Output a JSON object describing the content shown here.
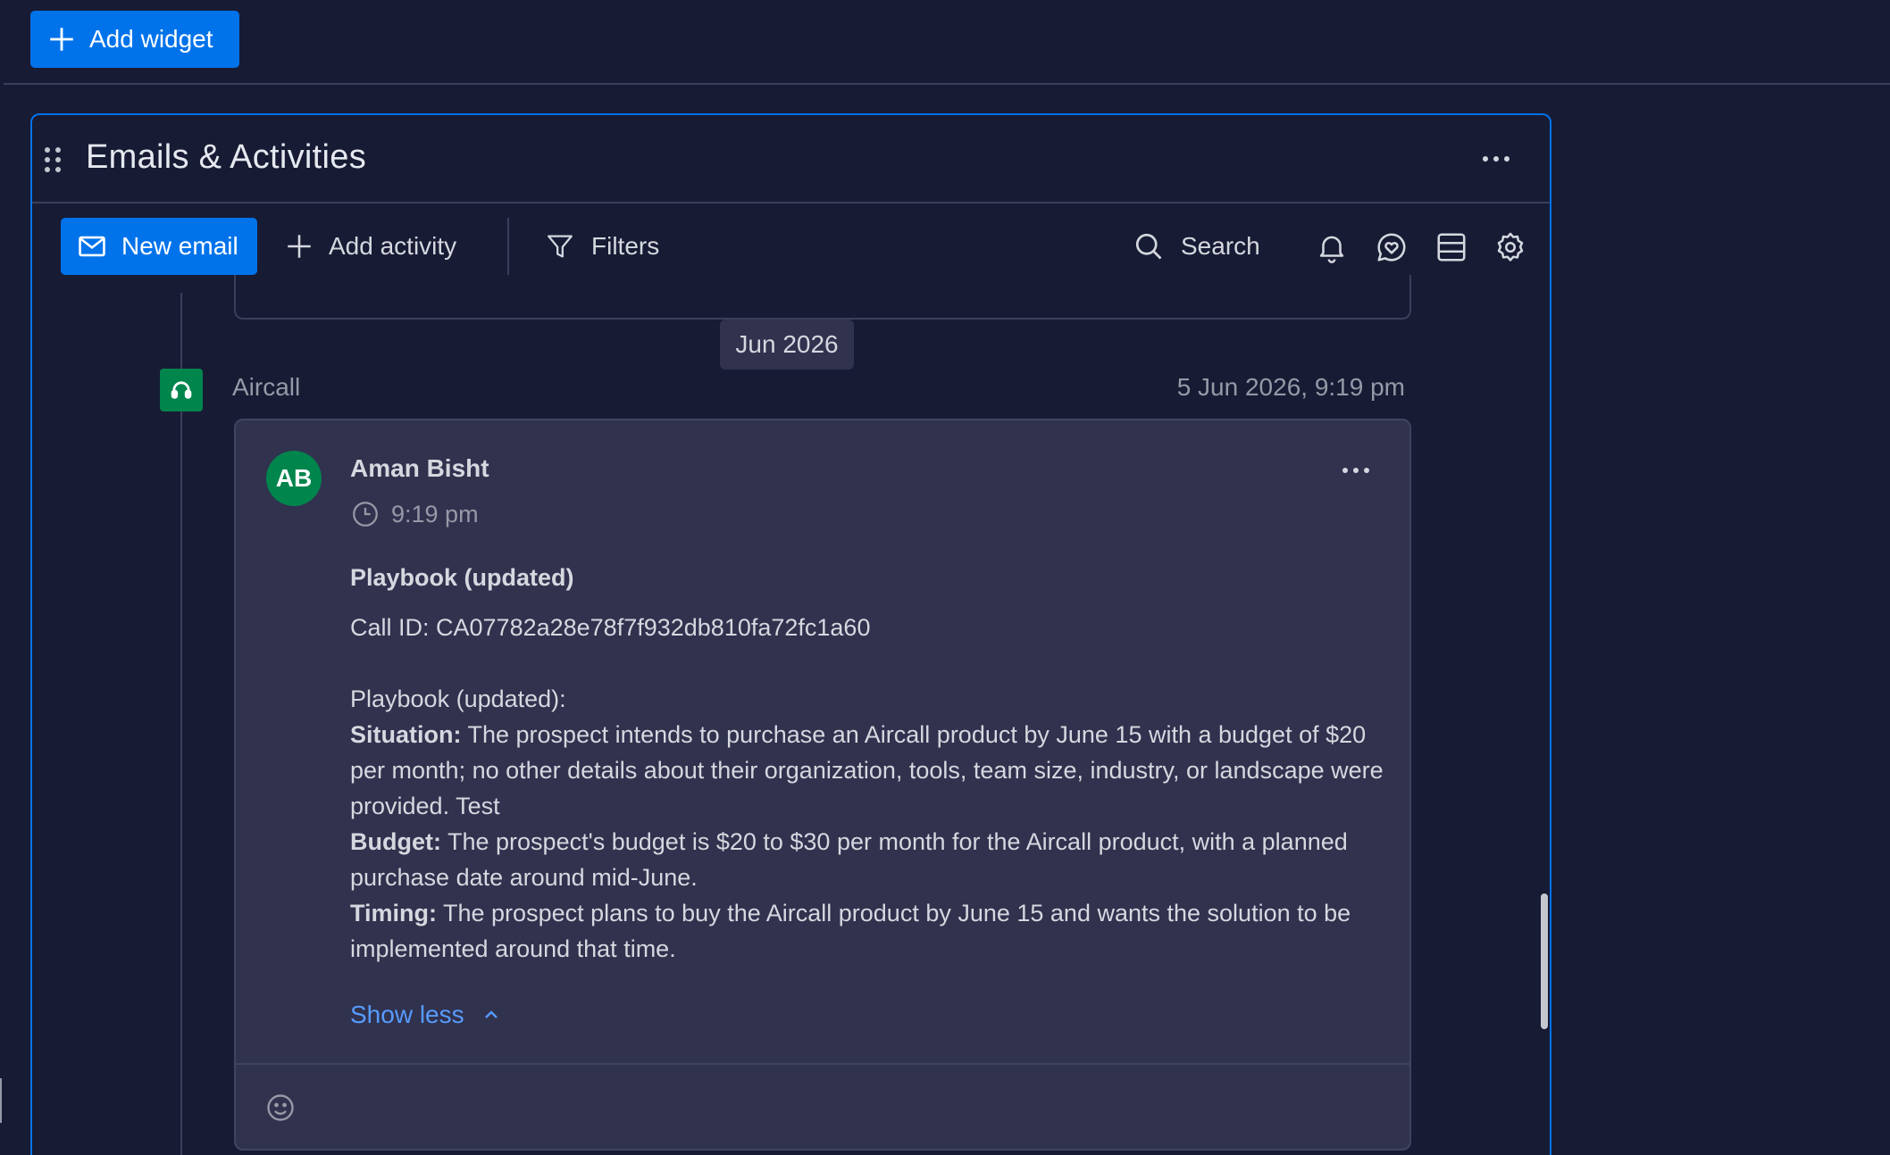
{
  "top_bar": {
    "add_widget_label": "Add widget"
  },
  "widget": {
    "title": "Emails & Activities",
    "toolbar": {
      "new_email_label": "New email",
      "add_activity_label": "Add activity",
      "filters_label": "Filters",
      "search_label": "Search"
    }
  },
  "feed": {
    "month_label": "Jun 2026",
    "item": {
      "source": "Aircall",
      "datetime": "5 Jun 2026, 9:19 pm",
      "avatar_initials": "AB",
      "author": "Aman Bisht",
      "time": "9:19 pm",
      "title": "Playbook (updated)",
      "call_id": "Call ID: CA07782a28e78f7f932db810fa72fc1a60",
      "body_heading": "Playbook (updated):",
      "situation_label": "Situation:",
      "situation_text": " The prospect intends to purchase an Aircall product by June 15 with a budget of $20 per month; no other details about their organization, tools, team size, industry, or landscape were provided. Test",
      "budget_label": "Budget:",
      "budget_text": " The prospect's budget is $20 to $30 per month for the Aircall product, with a planned purchase date around mid-June.",
      "timing_label": "Timing:",
      "timing_text": " The prospect plans to buy the Aircall product by June 15 and wants the solution to be implemented around that time.",
      "show_less_label": "Show less"
    }
  },
  "colors": {
    "background": "#181b34",
    "primary": "#0073ea",
    "card": "#30324e",
    "aircall_green": "#00854d",
    "link": "#579bfc"
  }
}
